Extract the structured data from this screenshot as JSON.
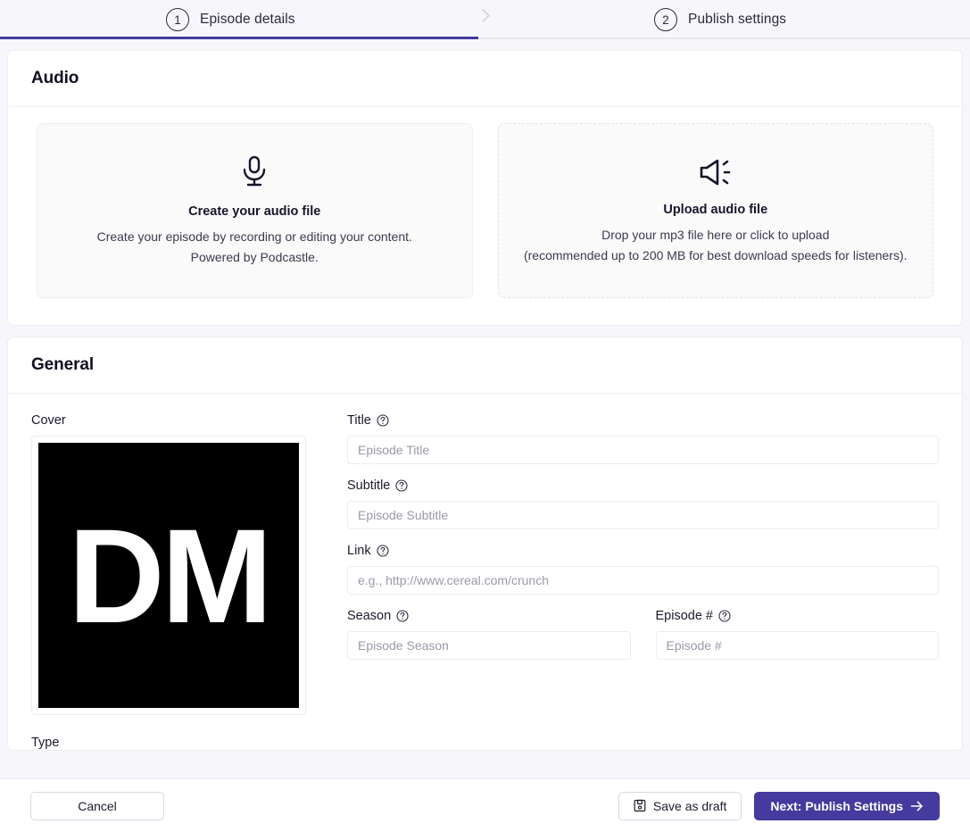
{
  "stepper": {
    "steps": [
      {
        "number": "1",
        "label": "Episode details",
        "active": true
      },
      {
        "number": "2",
        "label": "Publish settings",
        "active": false
      }
    ],
    "separator_icon": "chevron-right-icon",
    "active_color": "#453a9e"
  },
  "audio_section": {
    "title": "Audio",
    "create": {
      "icon": "microphone-icon",
      "heading": "Create your audio file",
      "line1": "Create your episode by recording or editing your content.",
      "line2": "Powered by Podcastle."
    },
    "upload": {
      "icon": "speaker-icon",
      "heading": "Upload audio file",
      "line1": "Drop your mp3 file here or click to upload",
      "line2": "(recommended up to 200 MB for best download speeds for listeners)."
    }
  },
  "general_section": {
    "title": "General",
    "cover_label": "Cover",
    "cover_text": "DM",
    "type_label": "Type",
    "fields": {
      "title": {
        "label": "Title",
        "placeholder": "Episode Title",
        "value": "",
        "help_icon": "question-circle-icon"
      },
      "subtitle": {
        "label": "Subtitle",
        "placeholder": "Episode Subtitle",
        "value": "",
        "help_icon": "question-circle-icon"
      },
      "link": {
        "label": "Link",
        "placeholder": "e.g., http://www.cereal.com/crunch",
        "value": "",
        "help_icon": "question-circle-icon"
      },
      "season": {
        "label": "Season",
        "placeholder": "Episode Season",
        "value": "",
        "help_icon": "question-circle-icon"
      },
      "episode_number": {
        "label": "Episode #",
        "placeholder": "Episode #",
        "value": "",
        "help_icon": "question-circle-icon"
      }
    }
  },
  "footer": {
    "cancel_label": "Cancel",
    "save_draft_label": "Save as draft",
    "save_draft_icon": "save-disk-icon",
    "next_label": "Next: Publish Settings",
    "next_icon": "arrow-right-icon",
    "primary_color": "#453a9e"
  }
}
